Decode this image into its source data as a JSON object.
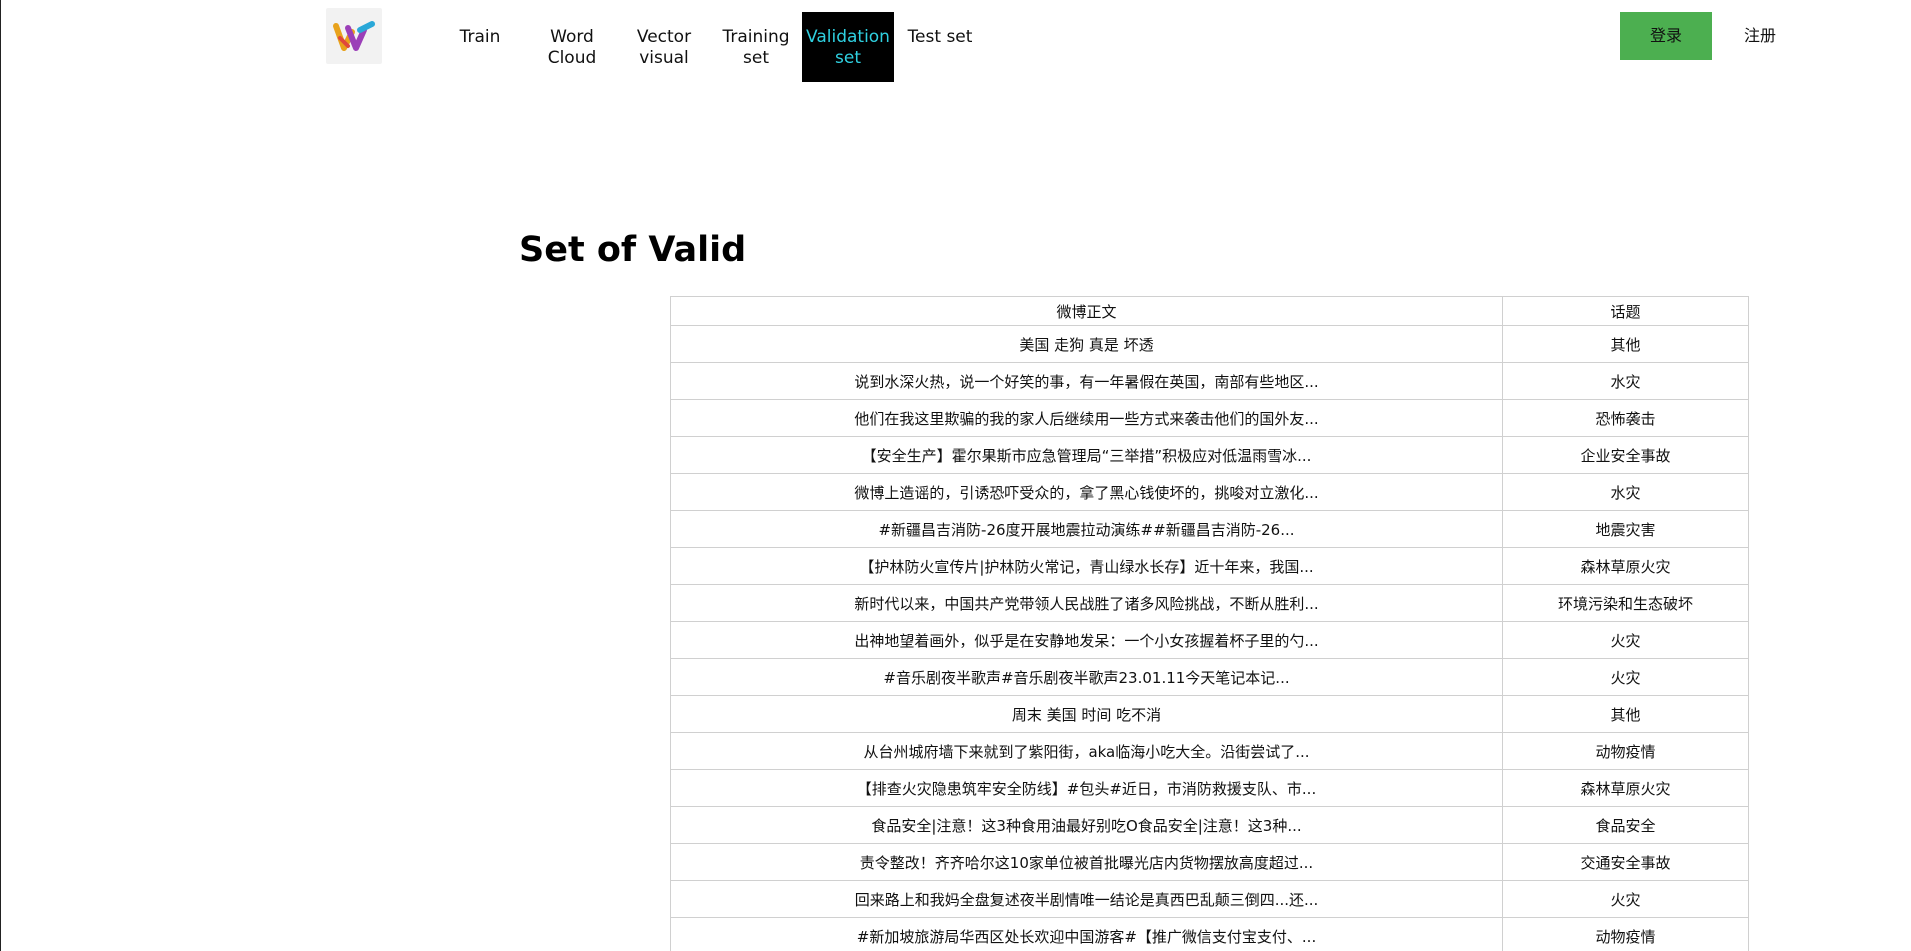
{
  "nav": {
    "items": [
      {
        "label": "Train",
        "active": false
      },
      {
        "label": "Word Cloud",
        "active": false
      },
      {
        "label": "Vector visual",
        "active": false
      },
      {
        "label": "Training set",
        "active": false
      },
      {
        "label": "Validation set",
        "active": true
      },
      {
        "label": "Test set",
        "active": false
      }
    ],
    "login_label": "登录",
    "register_label": "注册",
    "active_color": "#2fd0e0",
    "login_color": "#4caf50",
    "logo_icon": "colorful-w-logo-icon"
  },
  "main": {
    "title": "Set of Valid",
    "table": {
      "headers": [
        "微博正文",
        "话题"
      ],
      "rows": [
        [
          "美国 走狗 真是 坏透",
          "其他"
        ],
        [
          "说到水深火热，说一个好笑的事，有一年暑假在英国，南部有些地区...",
          "水灾"
        ],
        [
          "他们在我这里欺骗的我的家人后继续用一些方式来袭击他们的国外友...",
          "恐怖袭击"
        ],
        [
          "【安全生产】霍尔果斯市应急管理局“三举措”积极应对低温雨雪冰...",
          "企业安全事故"
        ],
        [
          "微博上造谣的，引诱恐吓受众的，拿了黑心钱使坏的，挑唆对立激化...",
          "水灾"
        ],
        [
          "#新疆昌吉消防-26度开展地震拉动演练##新疆昌吉消防-26...",
          "地震灾害"
        ],
        [
          "【护林防火宣传片|护林防火常记，青山绿水长存】近十年来，我国...",
          "森林草原火灾"
        ],
        [
          "新时代以来，中国共产党带领人民战胜了诸多风险挑战，不断从胜利...",
          "环境污染和生态破坏"
        ],
        [
          "出神地望着画外，似乎是在安静地发呆：一个小女孩握着杯子里的勺...",
          "火灾"
        ],
        [
          "#音乐剧夜半歌声#音乐剧夜半歌声23.01.11今天笔记本记...",
          "火灾"
        ],
        [
          "周末 美国 时间 吃不消",
          "其他"
        ],
        [
          "从台州城府墙下来就到了紫阳街，aka临海小吃大全。沿街尝试了...",
          "动物疫情"
        ],
        [
          "【排查火灾隐患筑牢安全防线】#包头#近日，市消防救援支队、市...",
          "森林草原火灾"
        ],
        [
          "食品安全|注意！这3种食用油最好别吃O食品安全|注意！这3种...",
          "食品安全"
        ],
        [
          "责令整改！齐齐哈尔这10家单位被首批曝光店内货物摆放高度超过...",
          "交通安全事故"
        ],
        [
          "回来路上和我妈全盘复述夜半剧情唯一结论是真西巴乱颠三倒四...还...",
          "火灾"
        ],
        [
          "#新加坡旅游局华西区处长欢迎中国游客#【推广微信支付宝支付、...",
          "动物疫情"
        ]
      ]
    }
  }
}
